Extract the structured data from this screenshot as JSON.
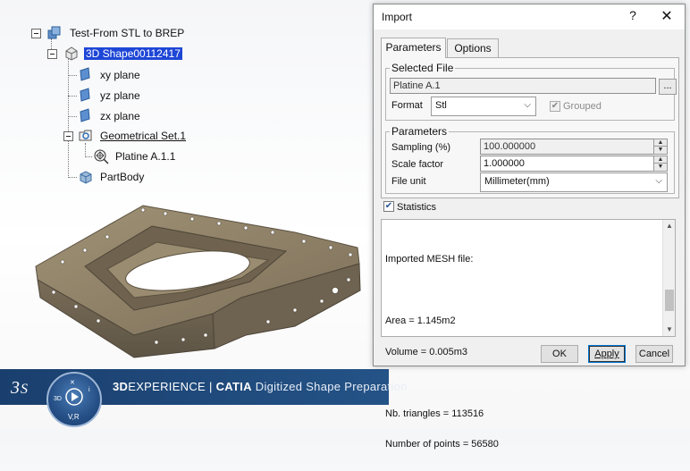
{
  "tree": {
    "root": "Test-From STL to BREP",
    "shape": "3D Shape00112417",
    "planes": [
      "xy plane",
      "yz plane",
      "zx plane"
    ],
    "geometrical_set": "Geometrical Set.1",
    "mesh_item": "Platine A.1.1",
    "part_body": "PartBody"
  },
  "brand": {
    "prefix": "3D",
    "experience": "EXPERIENCE",
    "separator": "|",
    "product": "CATIA",
    "app": "Digitized Shape Preparation",
    "compass_v": "V,R"
  },
  "dialog": {
    "title": "Import",
    "help": "?",
    "close": "✕",
    "tabs": [
      "Parameters",
      "Options"
    ],
    "selected_file": {
      "legend": "Selected File",
      "value": "Platine A.1",
      "browse": "..."
    },
    "format_label": "Format",
    "format_value": "Stl",
    "grouped_label": "Grouped",
    "parameters": {
      "legend": "Parameters",
      "sampling_label": "Sampling (%)",
      "sampling_value": "100.000000",
      "scale_label": "Scale factor",
      "scale_value": "1.000000",
      "unit_label": "File unit",
      "unit_value": "Millimeter(mm)"
    },
    "statistics_label": "Statistics",
    "statistics_lines": [
      "Imported MESH file:",
      "",
      "Area = 1.145m2",
      "Volume = 0.005m3",
      "",
      "Nb. triangles = 113516",
      "Number of points = 56580"
    ],
    "buttons": {
      "ok": "OK",
      "apply": "Apply",
      "cancel": "Cancel"
    }
  },
  "colors": {
    "selection": "#1e46d6",
    "brand_bar": "#245387",
    "part": "#8b7d62"
  }
}
